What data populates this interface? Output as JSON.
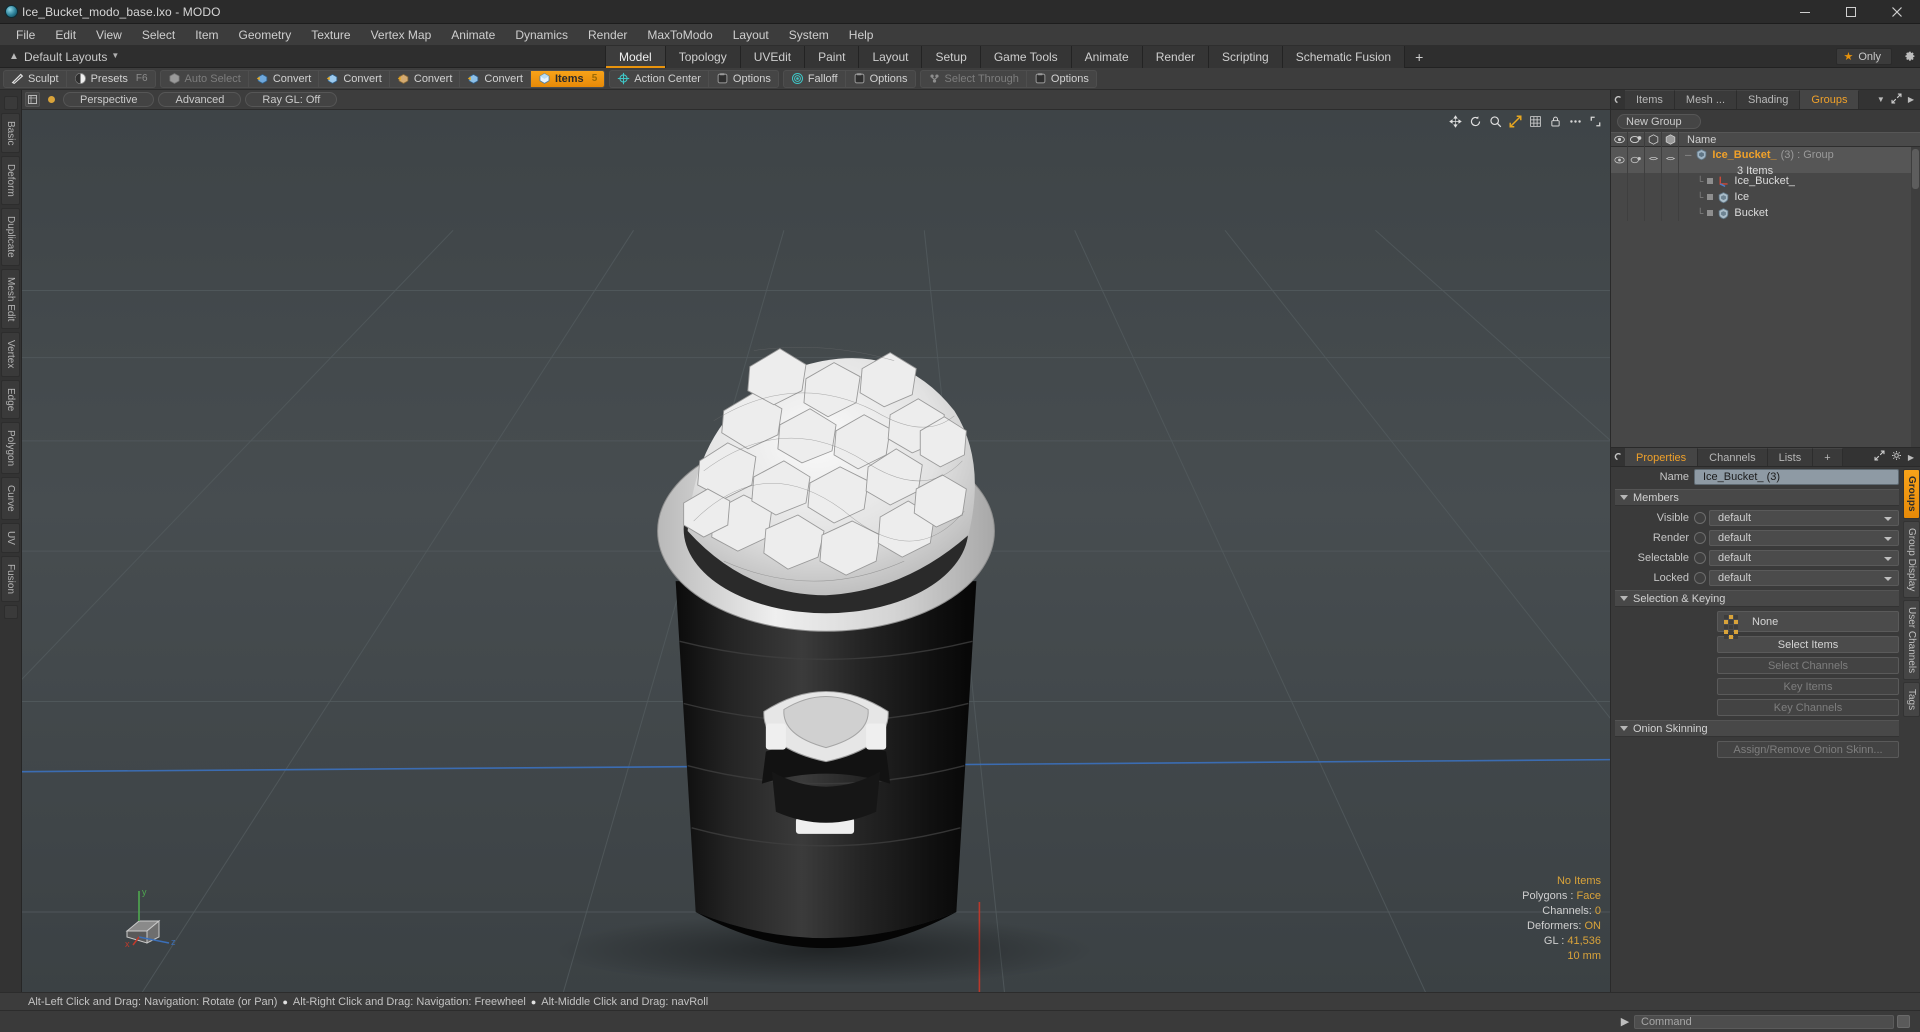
{
  "window": {
    "title": "Ice_Bucket_modo_base.lxo - MODO",
    "app_icon": "modo-logo-icon",
    "controls": {
      "minimize": "minimize-icon",
      "maximize": "maximize-icon",
      "close": "close-icon"
    }
  },
  "menubar": {
    "items": [
      "File",
      "Edit",
      "View",
      "Select",
      "Item",
      "Geometry",
      "Texture",
      "Vertex Map",
      "Animate",
      "Dynamics",
      "Render",
      "MaxToModo",
      "Layout",
      "System",
      "Help"
    ]
  },
  "layoutbar": {
    "layout_label": "Default Layouts",
    "tabs": [
      {
        "label": "Model",
        "active": true
      },
      {
        "label": "Topology",
        "active": false
      },
      {
        "label": "UVEdit",
        "active": false
      },
      {
        "label": "Paint",
        "active": false
      },
      {
        "label": "Layout",
        "active": false
      },
      {
        "label": "Setup",
        "active": false
      },
      {
        "label": "Game Tools",
        "active": false
      },
      {
        "label": "Animate",
        "active": false
      },
      {
        "label": "Render",
        "active": false
      },
      {
        "label": "Scripting",
        "active": false
      },
      {
        "label": "Schematic Fusion",
        "active": false
      }
    ],
    "add_tab_label": "+",
    "only_label": "Only",
    "star_icon": "star-icon",
    "gear_icon": "gear-icon"
  },
  "toolbar": {
    "group1": [
      {
        "label": "Sculpt",
        "icon": "sculpt-brush-icon",
        "state": "normal",
        "shortcut": ""
      },
      {
        "label": "Presets",
        "icon": "presets-sphere-icon",
        "state": "normal",
        "shortcut": "F6"
      }
    ],
    "group2": [
      {
        "label": "Auto Select",
        "icon": "cube-grey-icon",
        "state": "disabled",
        "shortcut": ""
      },
      {
        "label": "Convert",
        "icon": "convert-vertex-icon",
        "state": "normal",
        "shortcut": ""
      },
      {
        "label": "Convert",
        "icon": "convert-edge-icon",
        "state": "normal",
        "shortcut": ""
      },
      {
        "label": "Convert",
        "icon": "convert-polygon-icon",
        "state": "normal",
        "shortcut": ""
      },
      {
        "label": "Convert",
        "icon": "convert-material-icon",
        "state": "normal",
        "shortcut": ""
      },
      {
        "label": "Items",
        "icon": "items-cube-icon",
        "state": "active",
        "shortcut": "5"
      }
    ],
    "group3": [
      {
        "label": "Action Center",
        "icon": "action-center-icon",
        "state": "normal",
        "shortcut": ""
      },
      {
        "label": "Options",
        "icon": "options-square-icon",
        "state": "normal",
        "shortcut": ""
      }
    ],
    "group4": [
      {
        "label": "Falloff",
        "icon": "falloff-target-icon",
        "state": "normal",
        "shortcut": ""
      },
      {
        "label": "Options",
        "icon": "options-square-icon",
        "state": "normal",
        "shortcut": ""
      }
    ],
    "group5": [
      {
        "label": "Select Through",
        "icon": "select-through-icon",
        "state": "disabled",
        "shortcut": ""
      },
      {
        "label": "Options",
        "icon": "options-square-icon",
        "state": "normal",
        "shortcut": ""
      }
    ]
  },
  "leftrail": {
    "tabs": [
      "Basic",
      "Deform",
      "Duplicate",
      "Mesh Edit",
      "Vertex",
      "Edge",
      "Polygon",
      "Curve",
      "UV",
      "Fusion"
    ]
  },
  "viewport": {
    "header": {
      "view_mode": "Perspective",
      "shading": "Advanced",
      "raygl": "Ray GL: Off"
    },
    "corner_icons": [
      "move-view-icon",
      "rotate-view-icon",
      "zoom-view-icon",
      "fit-view-icon",
      "grid-view-icon",
      "lock-view-icon",
      "options-view-icon",
      "expand-view-icon"
    ],
    "stats": [
      {
        "label": "",
        "value": "No Items"
      },
      {
        "label": "Polygons :",
        "value": "Face"
      },
      {
        "label": "Channels:",
        "value": "0"
      },
      {
        "label": "Deformers:",
        "value": "ON"
      },
      {
        "label": "GL :",
        "value": "41,536"
      },
      {
        "label": "",
        "value": "10 mm"
      }
    ],
    "axis_labels": {
      "y": "y",
      "x": "x",
      "z": "z"
    },
    "model_name": "ice bucket with ice cubes"
  },
  "groups_panel": {
    "tabs": [
      {
        "label": "Items",
        "active": false
      },
      {
        "label": "Mesh ...",
        "active": false
      },
      {
        "label": "Shading",
        "active": false
      },
      {
        "label": "Groups",
        "active": true
      }
    ],
    "menu_icon": "chevron-down-icon",
    "expand_icon": "expand-panel-icon",
    "more_icon": "chevron-right-icon",
    "new_group_button": "New Group",
    "columns": {
      "visible_icon": "eye-icon",
      "render_icon": "render-icon",
      "wire_icon": "wireframe-cube-icon",
      "shade_icon": "shaded-cube-icon",
      "name": "Name"
    },
    "rows": [
      {
        "name": "Ice_Bucket_",
        "suffix": "(3) : Group",
        "sub": "3 Items",
        "icon": "group-shield-icon",
        "selected": true,
        "depth": 0
      },
      {
        "name": "Ice_Bucket_",
        "suffix": "",
        "sub": "",
        "icon": "locator-axis-icon",
        "selected": false,
        "depth": 1
      },
      {
        "name": "Ice",
        "suffix": "",
        "sub": "",
        "icon": "mesh-shield-icon",
        "selected": false,
        "depth": 1
      },
      {
        "name": "Bucket",
        "suffix": "",
        "sub": "",
        "icon": "mesh-shield-icon",
        "selected": false,
        "depth": 1
      }
    ]
  },
  "properties_panel": {
    "tabs": [
      {
        "label": "Properties",
        "active": true
      },
      {
        "label": "Channels",
        "active": false
      },
      {
        "label": "Lists",
        "active": false
      },
      {
        "label": "+",
        "active": false
      }
    ],
    "expand_icon": "expand-panel-icon",
    "gear_icon": "gear-icon",
    "more_icon": "chevron-right-icon",
    "name_label": "Name",
    "name_value": "Ice_Bucket_ (3)",
    "sections": [
      {
        "title": "Members",
        "fields": [
          {
            "label": "Visible",
            "value": "default",
            "type": "dropdown"
          },
          {
            "label": "Render",
            "value": "default",
            "type": "dropdown"
          },
          {
            "label": "Selectable",
            "value": "default",
            "type": "dropdown"
          },
          {
            "label": "Locked",
            "value": "default",
            "type": "dropdown"
          }
        ]
      },
      {
        "title": "Selection & Keying",
        "buttons": [
          {
            "label": "None",
            "type": "combo",
            "disabled": false
          },
          {
            "label": "Select Items",
            "type": "button",
            "disabled": false
          },
          {
            "label": "Select Channels",
            "type": "button",
            "disabled": true
          },
          {
            "label": "Key Items",
            "type": "button",
            "disabled": true
          },
          {
            "label": "Key Channels",
            "type": "button",
            "disabled": true
          }
        ]
      },
      {
        "title": "Onion Skinning",
        "buttons": [
          {
            "label": "Assign/Remove Onion Skinn...",
            "type": "button",
            "disabled": true
          }
        ]
      }
    ],
    "side_tabs": [
      {
        "label": "Groups",
        "active": true
      },
      {
        "label": "Group Display",
        "active": false
      },
      {
        "label": "User Channels",
        "active": false
      },
      {
        "label": "Tags",
        "active": false
      }
    ]
  },
  "statusbar": {
    "hints": [
      "Alt-Left Click and Drag: Navigation: Rotate (or Pan)",
      "Alt-Right Click and Drag: Navigation: Freewheel",
      "Alt-Middle Click and Drag: navRoll"
    ],
    "command_placeholder": "Command",
    "command_value": "",
    "chevron_icon": "chevron-right-icon",
    "go_icon": "execute-icon"
  },
  "colors": {
    "accent_orange": "#f0a12a",
    "panel_bg": "#3a3a3a",
    "toolbar_bg": "#3d3d3d",
    "viewport_bg": "#434a4d",
    "field_blue": "#8e9aa4",
    "axis_red": "#c0392b",
    "axis_blue": "#3b6fb8"
  }
}
